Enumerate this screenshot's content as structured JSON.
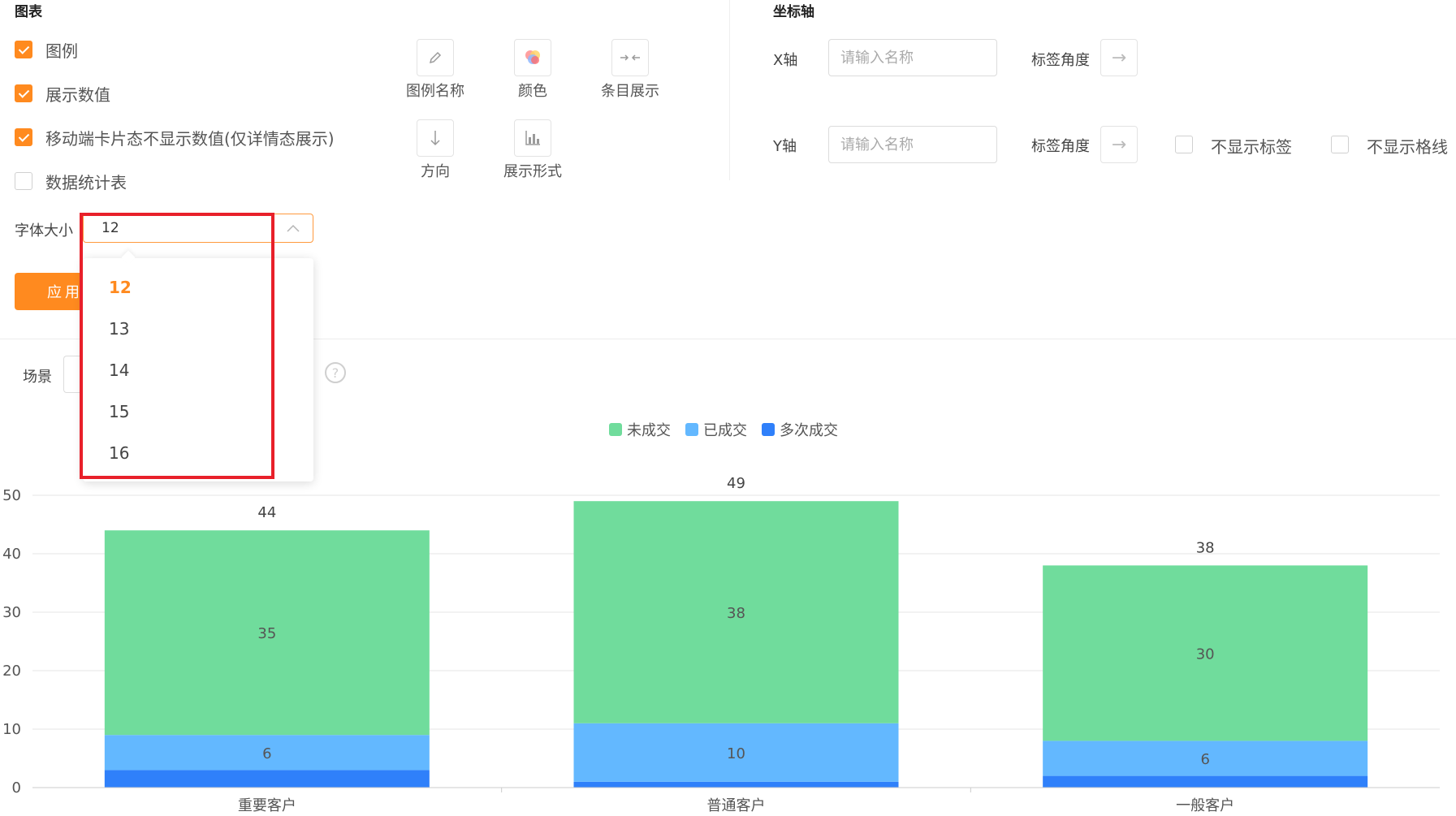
{
  "chart_section": {
    "title": "图表",
    "options": [
      {
        "label": "图例",
        "checked": true
      },
      {
        "label": "展示数值",
        "checked": true
      },
      {
        "label": "移动端卡片态不显示数值(仅详情态展示)",
        "checked": true
      },
      {
        "label": "数据统计表",
        "checked": false
      }
    ],
    "tools": [
      {
        "label": "图例名称",
        "icon": "pencil-icon"
      },
      {
        "label": "颜色",
        "icon": "color-palette-icon"
      },
      {
        "label": "条目展示",
        "icon": "collapse-arrows-icon"
      },
      {
        "label": "方向",
        "icon": "arrow-down-icon"
      },
      {
        "label": "展示形式",
        "icon": "bar-chart-icon"
      }
    ],
    "font_size_label": "字体大小",
    "font_size_value": "12",
    "apply_label": "应用",
    "font_size_options": [
      "12",
      "13",
      "14",
      "15",
      "16"
    ]
  },
  "axis_section": {
    "title": "坐标轴",
    "x_label": "X轴",
    "y_label": "Y轴",
    "name_placeholder": "请输入名称",
    "angle_label": "标签角度",
    "hide_labels": "不显示标签",
    "hide_grid": "不显示格线"
  },
  "scene": {
    "label": "场景"
  },
  "chart_data": {
    "type": "bar",
    "stacked": true,
    "categories": [
      "重要客户",
      "普通客户",
      "一般客户"
    ],
    "series": [
      {
        "name": "多次成交",
        "color": "#2f80fa",
        "values": [
          3,
          1,
          2
        ]
      },
      {
        "name": "已成交",
        "color": "#63b8ff",
        "values": [
          6,
          10,
          6
        ]
      },
      {
        "name": "未成交",
        "color": "#70dc9c",
        "values": [
          35,
          38,
          30
        ]
      }
    ],
    "totals": [
      44,
      49,
      38
    ],
    "ylim": [
      0,
      50
    ],
    "yticks": [
      "0",
      "10",
      "20",
      "30",
      "40",
      "50"
    ],
    "legend": [
      "未成交",
      "已成交",
      "多次成交"
    ],
    "legend_position": "top-center",
    "grid": true
  }
}
